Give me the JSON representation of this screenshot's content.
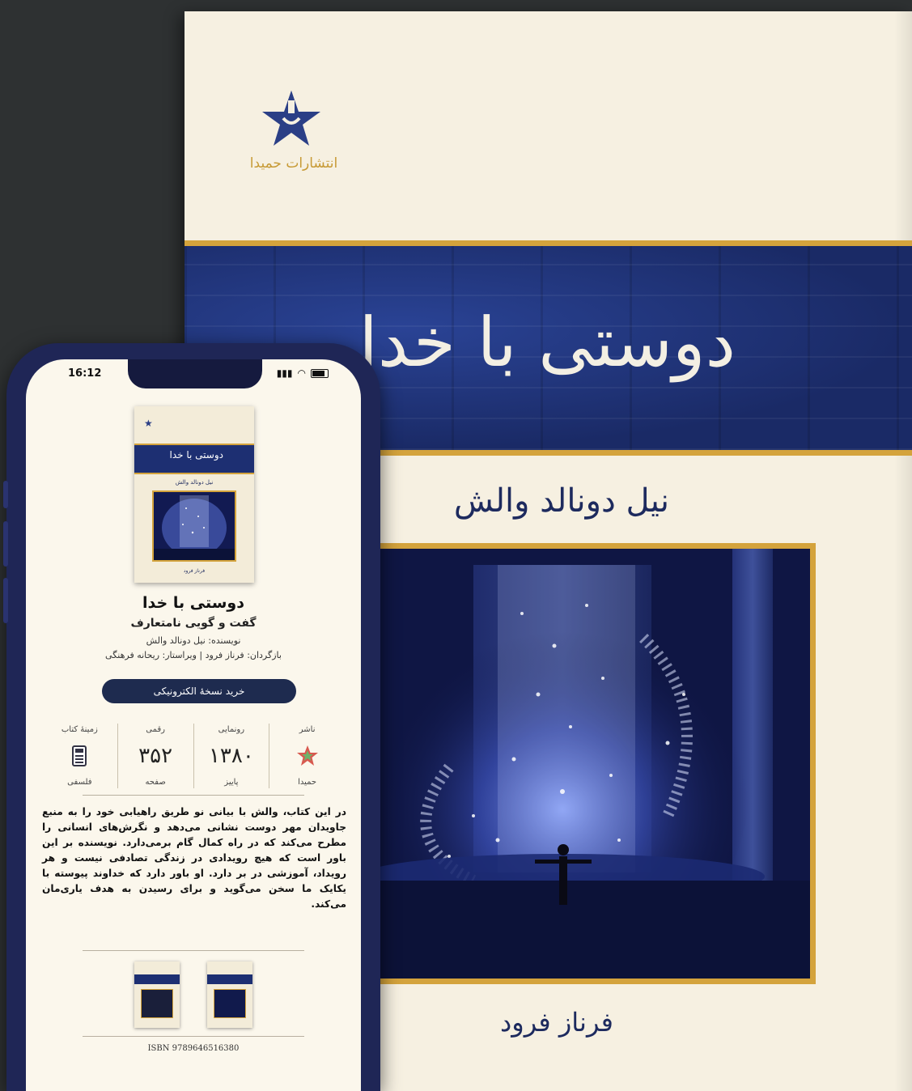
{
  "book_cover": {
    "publisher_name": "انتشارات حمیدا",
    "title": "دوستی با خدا",
    "author": "نیل دونالد والش",
    "translator": "فرناز فرود"
  },
  "phone": {
    "status_time": "16:12",
    "book": {
      "title": "دوستی با خدا",
      "subtitle": "گفت و گویی نامتعارف",
      "author_line": "نویسنده: نیل دونالد والش",
      "credits_line": "بازگردان: فرناز فرود | ویراستار: ریحانه فرهنگی"
    },
    "buy_button_label": "خرید نسخهٔ الکترونیکی",
    "info": [
      {
        "label": "ناشر",
        "value": "",
        "sub": "حمیدا",
        "kind": "logo"
      },
      {
        "label": "رونمایی",
        "value": "۱۳۸۰",
        "sub": "پاییز",
        "kind": "number"
      },
      {
        "label": "رقمی",
        "value": "۳۵۲",
        "sub": "صفحه",
        "kind": "number"
      },
      {
        "label": "زمینهٔ کتاب",
        "value": "",
        "sub": "فلسفی",
        "kind": "calculator-icon"
      }
    ],
    "description": "در این کتاب، والش با بیانی نو طریق راهیابی خود را به منبع جاویدان مهر دوست نشانی می‌دهد و نگرش‌های انسانی را مطرح می‌کند که در راه کمال گام برمی‌دارد. نویسنده بر این باور است که هیچ رویدادی در زندگی تصادفی نیست و هر رویداد، آموزشی در بر دارد. او باور دارد که خداوند پیوسته با یکایک ما سخن می‌گوید و برای رسیدن به هدف یاری‌مان می‌کند.",
    "isbn": "ISBN 9789646516380"
  },
  "colors": {
    "background": "#2e3132",
    "cover_cream": "#f6f0e1",
    "navy": "#1d2f72",
    "gold": "#d4a33c"
  }
}
